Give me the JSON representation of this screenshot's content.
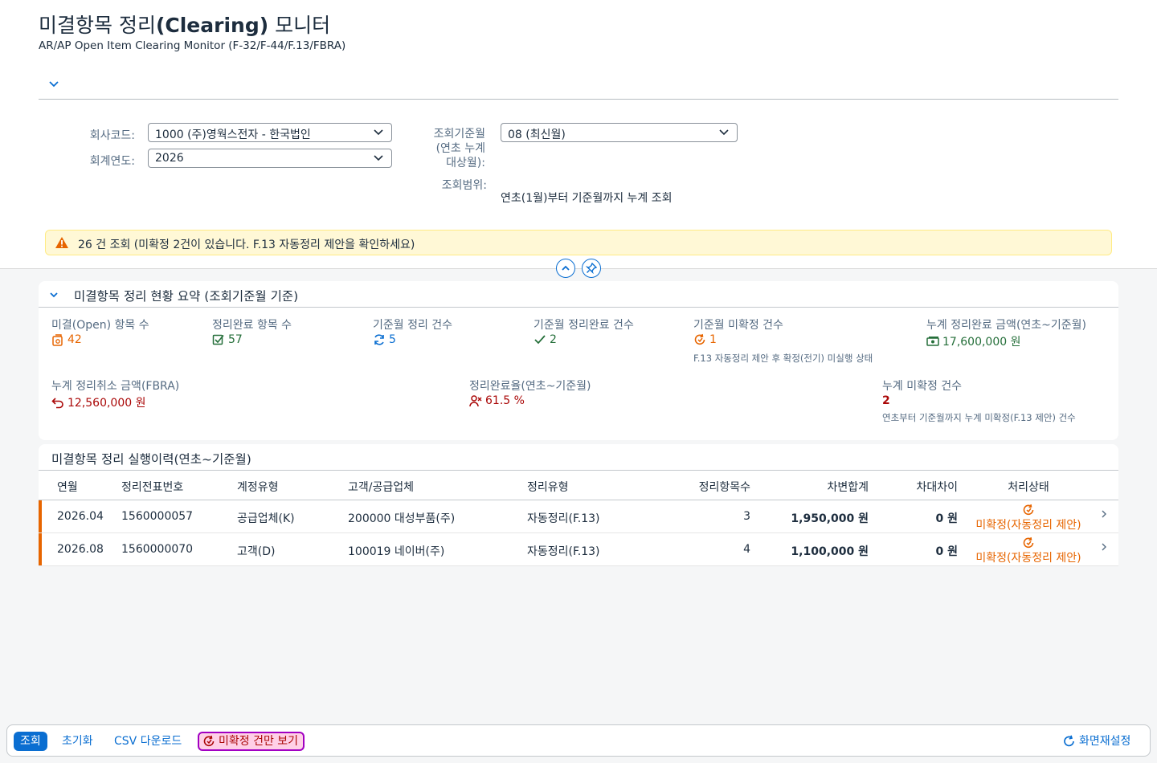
{
  "header": {
    "title_pre": "미결항목 정리",
    "title_bold": "(Clearing)",
    "title_post": " 모니터",
    "subtitle": "AR/AP Open Item Clearing Monitor (F-32/F-44/F.13/FBRA)"
  },
  "filters": {
    "company_label": "회사코드:",
    "company_value": "1000 (주)영웍스전자 - 한국법인",
    "year_label": "회계연도:",
    "year_value": "2026",
    "period_label_1": "조회기준월",
    "period_label_2": "(연초 누계",
    "period_label_3": "대상월):",
    "period_value": "08 (최신월)",
    "range_label": "조회범위:",
    "range_value": "연초(1월)부터 기준월까지 누계 조회"
  },
  "message": {
    "text": "26 건 조회 (미확정 2건이 있습니다. F.13 자동정리 제안을 확인하세요)"
  },
  "summary": {
    "title": "미결항목 정리 현황 요약 (조회기준월 기준)",
    "kpis": [
      {
        "label": "미결(Open) 항목 수",
        "value": "42",
        "icon": "open-items-icon"
      },
      {
        "label": "정리완료 항목 수",
        "value": "57",
        "icon": "checkbox-icon"
      },
      {
        "label": "기준월 정리 건수",
        "value": "5",
        "icon": "refresh-icon"
      },
      {
        "label": "기준월 정리완료 건수",
        "value": "2",
        "icon": "check-icon"
      },
      {
        "label": "기준월 미확정 건수",
        "value": "1",
        "icon": "pending-icon",
        "note": "F.13 자동정리 제안 후 확정(전기) 미실행 상태"
      },
      {
        "label": "누계 정리완료 금액(연초~기준월)",
        "value": "17,600,000 원",
        "icon": "money-icon"
      },
      {
        "label": "누계 정리취소 금액(FBRA)",
        "value": "12,560,000 원",
        "icon": "undo-icon"
      },
      {
        "label": "정리완료율(연초~기준월)",
        "value": "61.5 %",
        "icon": "rate-icon"
      },
      {
        "label": "누계 미확정 건수",
        "value": "2",
        "note": "연초부터 기준월까지 누계 미확정(F.13 제안) 건수"
      }
    ]
  },
  "history": {
    "title": "미결항목 정리 실행이력(연초~기준월)",
    "columns": [
      "연월",
      "정리전표번호",
      "계정유형",
      "고객/공급업체",
      "정리유형",
      "정리항목수",
      "차변합계",
      "차대차이",
      "처리상태"
    ],
    "rows": [
      {
        "period": "2026.04",
        "doc": "1560000057",
        "acct_type": "공급업체(K)",
        "partner": "200000 대성부품(주)",
        "clearing_type": "자동정리(F.13)",
        "count": "3",
        "debit": "1,950,000 원",
        "diff": "0 원",
        "status": "미확정(자동정리 제안)"
      },
      {
        "period": "2026.08",
        "doc": "1560000070",
        "acct_type": "고객(D)",
        "partner": "100019 네이버(주)",
        "clearing_type": "자동정리(F.13)",
        "count": "4",
        "debit": "1,100,000 원",
        "diff": "0 원",
        "status": "미확정(자동정리 제안)"
      }
    ]
  },
  "footer": {
    "search": "조회",
    "reset": "초기화",
    "csv": "CSV 다운로드",
    "pending_only": "미확정 건만 보기",
    "layout_reset": "화면재설정"
  },
  "colors": {
    "accent": "#0a6ed1",
    "warning": "#e76500",
    "positive": "#256f3a",
    "negative": "#aa0808",
    "message_bg": "#fff8d6"
  }
}
